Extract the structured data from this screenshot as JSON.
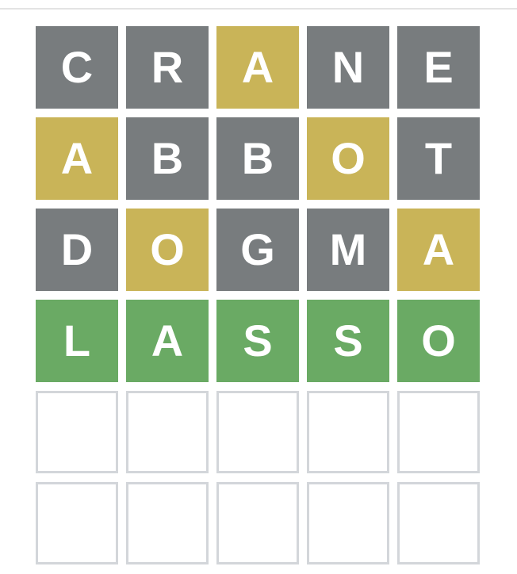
{
  "colors": {
    "absent": "#787c7e",
    "present": "#c9b458",
    "correct": "#6aaa64",
    "empty_border": "#d3d6da"
  },
  "board": {
    "rows": [
      [
        {
          "letter": "C",
          "state": "absent"
        },
        {
          "letter": "R",
          "state": "absent"
        },
        {
          "letter": "A",
          "state": "present"
        },
        {
          "letter": "N",
          "state": "absent"
        },
        {
          "letter": "E",
          "state": "absent"
        }
      ],
      [
        {
          "letter": "A",
          "state": "present"
        },
        {
          "letter": "B",
          "state": "absent"
        },
        {
          "letter": "B",
          "state": "absent"
        },
        {
          "letter": "O",
          "state": "present"
        },
        {
          "letter": "T",
          "state": "absent"
        }
      ],
      [
        {
          "letter": "D",
          "state": "absent"
        },
        {
          "letter": "O",
          "state": "present"
        },
        {
          "letter": "G",
          "state": "absent"
        },
        {
          "letter": "M",
          "state": "absent"
        },
        {
          "letter": "A",
          "state": "present"
        }
      ],
      [
        {
          "letter": "L",
          "state": "correct"
        },
        {
          "letter": "A",
          "state": "correct"
        },
        {
          "letter": "S",
          "state": "correct"
        },
        {
          "letter": "S",
          "state": "correct"
        },
        {
          "letter": "O",
          "state": "correct"
        }
      ],
      [
        {
          "letter": "",
          "state": "empty"
        },
        {
          "letter": "",
          "state": "empty"
        },
        {
          "letter": "",
          "state": "empty"
        },
        {
          "letter": "",
          "state": "empty"
        },
        {
          "letter": "",
          "state": "empty"
        }
      ],
      [
        {
          "letter": "",
          "state": "empty"
        },
        {
          "letter": "",
          "state": "empty"
        },
        {
          "letter": "",
          "state": "empty"
        },
        {
          "letter": "",
          "state": "empty"
        },
        {
          "letter": "",
          "state": "empty"
        }
      ]
    ]
  }
}
